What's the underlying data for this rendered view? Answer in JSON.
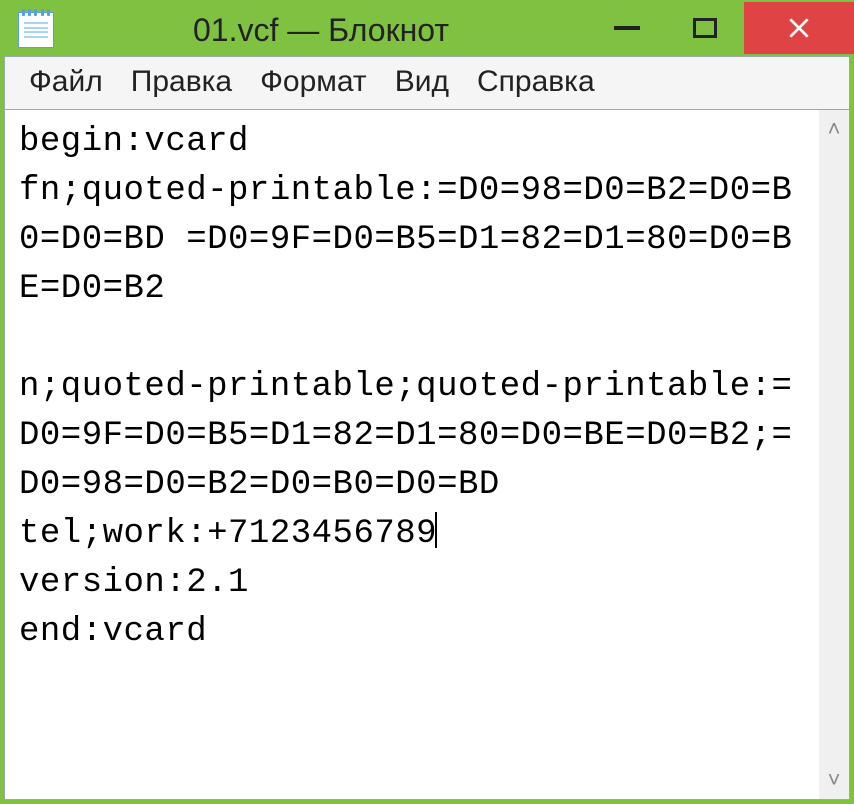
{
  "window": {
    "title": "01.vcf — Блокнот"
  },
  "menu": {
    "file": "Файл",
    "edit": "Правка",
    "format": "Формат",
    "view": "Вид",
    "help": "Справка"
  },
  "editor": {
    "line1": "begin:vcard",
    "line2": "fn;quoted-printable:=D0=98=D0=B2=D0=B0=D0=BD =D0=9F=D0=B5=D1=82=D1=80=D0=BE=D0=B2",
    "line3": "",
    "line4": "n;quoted-printable;quoted-printable:=D0=9F=D0=B5=D1=82=D1=80=D0=BE=D0=B2;=D0=98=D0=B2=D0=B0=D0=BD",
    "line5_pre": "tel;work:+7123456789",
    "line6": "version:2.1",
    "line7": "end:vcard"
  },
  "scroll": {
    "up": "˄",
    "down": "˅"
  }
}
